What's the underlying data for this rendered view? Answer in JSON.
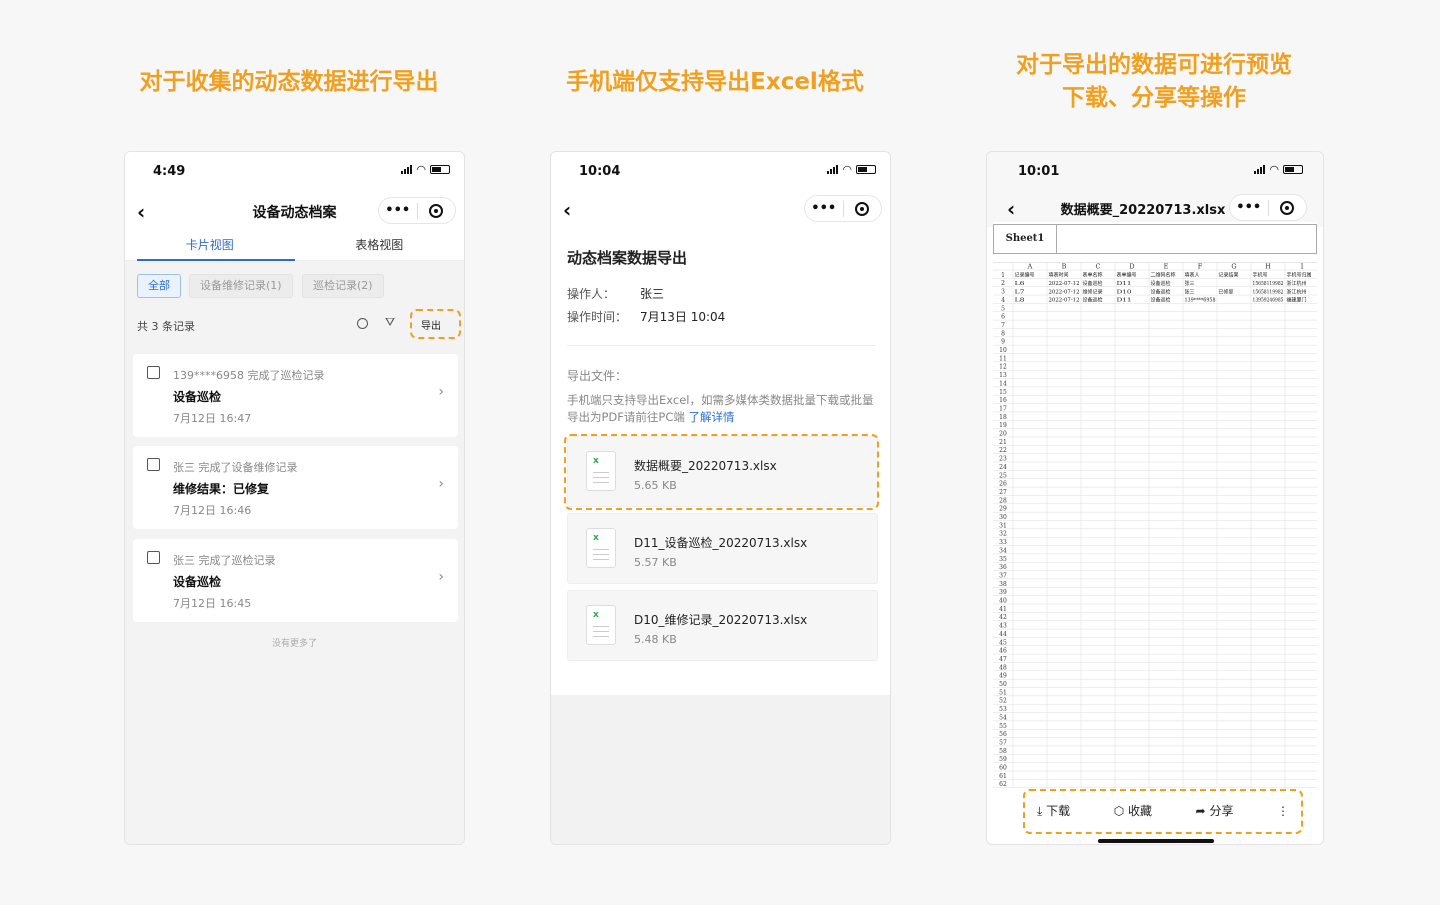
{
  "captions": {
    "c1": "对于收集的动态数据进行导出",
    "c2": "手机端仅支持导出Excel格式",
    "c3_line1": "对于导出的数据可进行预览",
    "c3_line2": "下载、分享等操作"
  },
  "colors": {
    "accent": "#f0a020",
    "brand_blue": "#2d6bd0",
    "excel_green": "#33a853"
  },
  "phone1": {
    "time": "4:49",
    "title": "设备动态档案",
    "tabs": [
      "卡片视图",
      "表格视图"
    ],
    "chips": [
      "全部",
      "设备维修记录(1)",
      "巡检记录(2)"
    ],
    "count": "共 3 条记录",
    "export_label": "导出",
    "cards": [
      {
        "who": "139****6958 完成了巡检记录",
        "main": "设备巡检",
        "date": "7月12日 16:47"
      },
      {
        "who": "张三 完成了设备维修记录",
        "main": "维修结果：已修复",
        "date": "7月12日 16:46"
      },
      {
        "who": "张三 完成了巡检记录",
        "main": "设备巡检",
        "date": "7月12日 16:45"
      }
    ],
    "no_more": "没有更多了"
  },
  "phone2": {
    "time": "10:04",
    "heading": "动态档案数据导出",
    "operator_label": "操作人：",
    "operator": "张三",
    "optime_label": "操作时间：",
    "optime": "7月13日 10:04",
    "file_label": "导出文件：",
    "hint": "手机端只支持导出Excel，如需多媒体类数据批量下载或批量导出为PDF请前往PC端",
    "hint_link": "了解详情",
    "files": [
      {
        "name": "数据概要_20220713.xlsx",
        "size": "5.65 KB"
      },
      {
        "name": "D11_设备巡检_20220713.xlsx",
        "size": "5.57 KB"
      },
      {
        "name": "D10_维修记录_20220713.xlsx",
        "size": "5.48 KB"
      }
    ]
  },
  "phone3": {
    "time": "10:01",
    "title": "数据概要_20220713.xlsx",
    "sheet_tab": "Sheet1",
    "columns": [
      "A",
      "B",
      "C",
      "D",
      "E",
      "F",
      "G",
      "H",
      "I"
    ],
    "header_row": [
      "记录编号",
      "填表时间",
      "表单名称",
      "表单编号",
      "二维码名称",
      "填表人",
      "记录结果",
      "手机号",
      "手机号归属"
    ],
    "rows": [
      [
        "L6",
        "2022-07-12",
        "设备巡检",
        "D11",
        "设备巡检",
        "张三",
        "",
        "15658119982",
        "浙江杭州"
      ],
      [
        "L7",
        "2022-07-12",
        "维修记录",
        "D10",
        "设备巡检",
        "张三",
        "已修复",
        "15658119982",
        "浙江杭州"
      ],
      [
        "L8",
        "2022-07-12",
        "设备巡检",
        "D11",
        "设备巡检",
        "139****6958",
        "",
        "13959246985",
        "福建厦门"
      ]
    ],
    "actions": {
      "download": "下载",
      "favorite": "收藏",
      "share": "分享",
      "more": "⋮"
    }
  }
}
